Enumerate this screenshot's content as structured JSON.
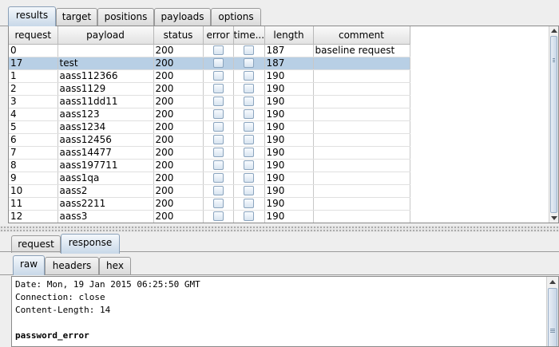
{
  "main_tabs": [
    "results",
    "target",
    "positions",
    "payloads",
    "options"
  ],
  "main_active_tab": "results",
  "table": {
    "columns": [
      "request",
      "payload",
      "status",
      "error",
      "time...",
      "length",
      "comment"
    ],
    "rows": [
      {
        "request": "0",
        "payload": "",
        "status": "200",
        "error": false,
        "timeout": false,
        "length": "187",
        "comment": "baseline request",
        "selected": false
      },
      {
        "request": "17",
        "payload": "test",
        "status": "200",
        "error": false,
        "timeout": false,
        "length": "187",
        "comment": "",
        "selected": true
      },
      {
        "request": "1",
        "payload": "aass112366",
        "status": "200",
        "error": false,
        "timeout": false,
        "length": "190",
        "comment": "",
        "selected": false
      },
      {
        "request": "2",
        "payload": "aass1129",
        "status": "200",
        "error": false,
        "timeout": false,
        "length": "190",
        "comment": "",
        "selected": false
      },
      {
        "request": "3",
        "payload": "aass11dd11",
        "status": "200",
        "error": false,
        "timeout": false,
        "length": "190",
        "comment": "",
        "selected": false
      },
      {
        "request": "4",
        "payload": "aass123",
        "status": "200",
        "error": false,
        "timeout": false,
        "length": "190",
        "comment": "",
        "selected": false
      },
      {
        "request": "5",
        "payload": "aass1234",
        "status": "200",
        "error": false,
        "timeout": false,
        "length": "190",
        "comment": "",
        "selected": false
      },
      {
        "request": "6",
        "payload": "aass12456",
        "status": "200",
        "error": false,
        "timeout": false,
        "length": "190",
        "comment": "",
        "selected": false
      },
      {
        "request": "7",
        "payload": "aass14477",
        "status": "200",
        "error": false,
        "timeout": false,
        "length": "190",
        "comment": "",
        "selected": false
      },
      {
        "request": "8",
        "payload": "aass197711",
        "status": "200",
        "error": false,
        "timeout": false,
        "length": "190",
        "comment": "",
        "selected": false
      },
      {
        "request": "9",
        "payload": "aass1qa",
        "status": "200",
        "error": false,
        "timeout": false,
        "length": "190",
        "comment": "",
        "selected": false
      },
      {
        "request": "10",
        "payload": "aass2",
        "status": "200",
        "error": false,
        "timeout": false,
        "length": "190",
        "comment": "",
        "selected": false
      },
      {
        "request": "11",
        "payload": "aass2211",
        "status": "200",
        "error": false,
        "timeout": false,
        "length": "190",
        "comment": "",
        "selected": false
      },
      {
        "request": "12",
        "payload": "aass3",
        "status": "200",
        "error": false,
        "timeout": false,
        "length": "190",
        "comment": "",
        "selected": false
      }
    ]
  },
  "detail_tabs": [
    "request",
    "response"
  ],
  "detail_active_tab": "response",
  "view_tabs": [
    "raw",
    "headers",
    "hex"
  ],
  "view_active_tab": "raw",
  "response_lines": [
    {
      "text": "Date: Mon, 19 Jan 2015 06:25:50 GMT",
      "bold": false
    },
    {
      "text": "Connection: close",
      "bold": false
    },
    {
      "text": "Content-Length: 14",
      "bold": false
    },
    {
      "text": "",
      "bold": false
    },
    {
      "text": "password_error",
      "bold": true
    }
  ],
  "colors": {
    "selected_row": "#b8cfe5",
    "active_tab": "#c8d8e8",
    "background": "#eeeeee"
  }
}
